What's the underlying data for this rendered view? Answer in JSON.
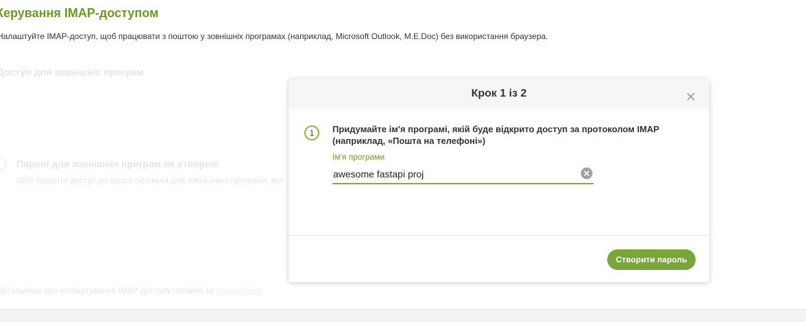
{
  "page": {
    "title": "Керування IMAP-доступом",
    "description": "Налаштуйте IMAP-доступ, щоб працювати з поштою у зовнішніх програмах (наприклад, Microsoft Outlook, M.E.Doc) без використання браузера.",
    "section_heading": "Доступ для зовнішніх програм",
    "empty_state": {
      "title": "Паролі для зовнішніх програм не створені",
      "text": "Щоб відкрити доступ до вашої скриньки для зовнішньої програми, вкл"
    },
    "more_info": {
      "text": "Детальніше про налаштування IMAP-доступу читайте за ",
      "link_label": "посиланням"
    }
  },
  "modal": {
    "title": "Крок 1 із 2",
    "step_number": "1",
    "instruction": "Придумайте ім'я програмі, якій буде відкрито доступ за протоколом IMAP (наприклад, «Пошта на телефоні»)",
    "field": {
      "label": "Ім'я програми",
      "value": "awesome fastapi proj"
    },
    "primary_button_label": "Створити пароль",
    "close_icon": "close-icon",
    "clear_icon": "clear-input-icon"
  },
  "colors": {
    "accent": "#6a9a1f",
    "button": "#7aa53a",
    "field_underline": "#84ad3d",
    "header_bg": "#f6f6f6"
  }
}
